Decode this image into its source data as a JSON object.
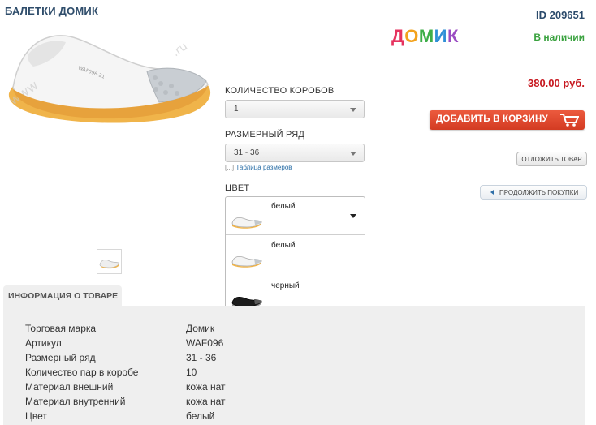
{
  "product": {
    "title": "БАЛЕТКИ ДОМИК",
    "id": "ID 209651",
    "brand_logo_text": "ДОМИК",
    "availability": "В наличии",
    "price": "380.00 руб."
  },
  "options": {
    "boxes_label": "КОЛИЧЕСТВО КОРОБОВ",
    "boxes_value": "1",
    "size_label": "РАЗМЕРНЫЙ РЯД",
    "size_value": "31 - 36",
    "size_table_prefix": "[...]",
    "size_table_link": "Таблица размеров",
    "color_label": "ЦВЕТ",
    "color_selected": "белый",
    "color_options": [
      "белый",
      "черный"
    ]
  },
  "actions": {
    "add_to_cart": "ДОБАВИТЬ В КОРЗИНУ",
    "defer": "ОТЛОЖИТЬ ТОВАР",
    "continue": "ПРОДОЛЖИТЬ ПОКУПКИ"
  },
  "info": {
    "tab": "ИНФОРМАЦИЯ О ТОВАРЕ",
    "rows": [
      {
        "k": "Торговая марка",
        "v": "Домик"
      },
      {
        "k": "Артикул",
        "v": "WAF096"
      },
      {
        "k": "Размерный ряд",
        "v": "31 - 36"
      },
      {
        "k": "Количество пар в коробе",
        "v": "10"
      },
      {
        "k": "Материал внешний",
        "v": "кожа нат"
      },
      {
        "k": "Материал внутренний",
        "v": "кожа нат"
      },
      {
        "k": "Цвет",
        "v": "белый"
      }
    ]
  },
  "colors": {
    "accent_red": "#c7181f",
    "cart_button": "#e04a2f",
    "stock_green": "#3aa23f",
    "title_blue": "#2f4d6b"
  },
  "icons": {
    "cart": "shopping-cart-icon",
    "select_arrow": "chevron-down-icon",
    "back": "triangle-left-icon"
  }
}
